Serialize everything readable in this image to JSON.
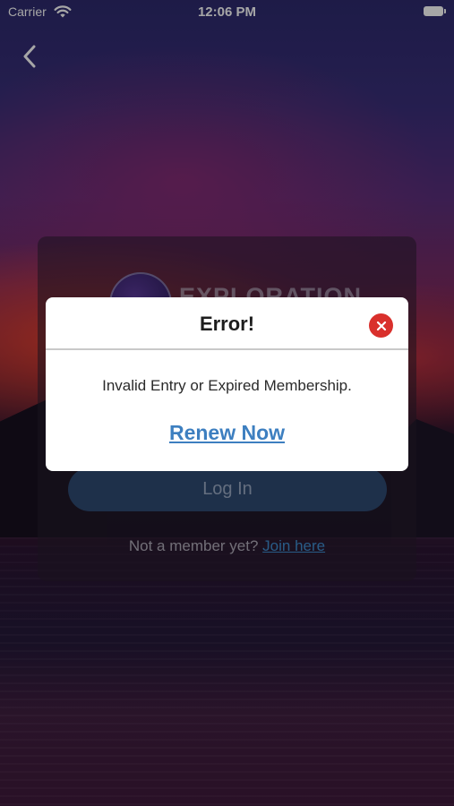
{
  "status_bar": {
    "carrier": "Carrier",
    "time": "12:06 PM"
  },
  "nav": {
    "back_icon": "chevron-left-icon"
  },
  "login_card": {
    "logo_text": "EXPLORATION",
    "login_button": "Log In",
    "signup_prompt": "Not a member yet?",
    "signup_link": "Join here"
  },
  "dialog": {
    "title": "Error!",
    "message": "Invalid Entry or Expired Membership.",
    "action_link": "Renew Now",
    "close_icon": "close-icon"
  },
  "colors": {
    "link_blue": "#3d7fc0",
    "close_red": "#d9302c",
    "login_button": "#2f4a72"
  }
}
